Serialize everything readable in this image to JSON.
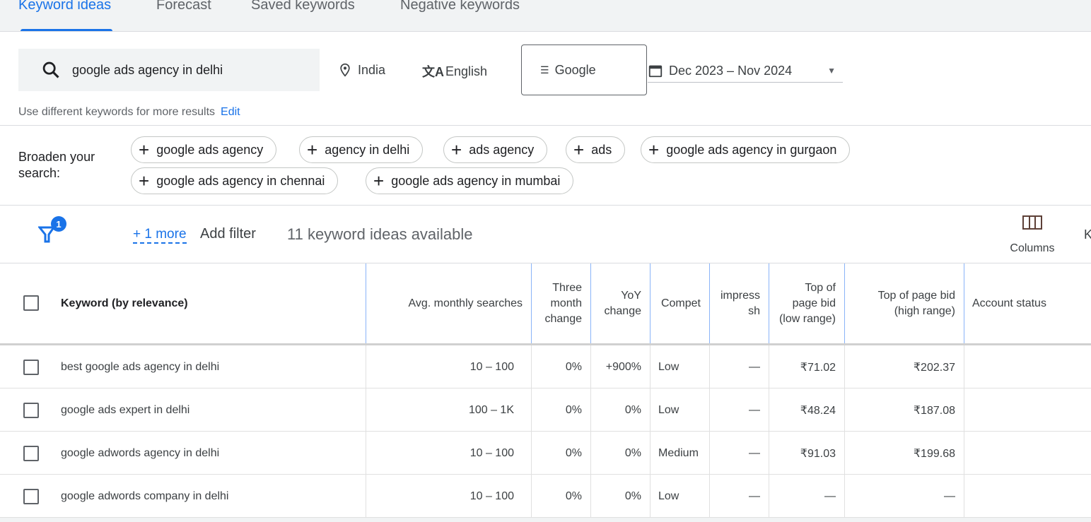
{
  "tabs": [
    {
      "label": "Keyword ideas",
      "active": true
    },
    {
      "label": "Forecast"
    },
    {
      "label": "Saved keywords"
    },
    {
      "label": "Negative keywords"
    }
  ],
  "search": {
    "value": "google ads agency in delhi",
    "icon": "search-icon"
  },
  "location": {
    "label": "India",
    "icon": "location-pin-icon"
  },
  "language": {
    "label": "English",
    "icon": "translate-icon"
  },
  "network": {
    "label": "Google",
    "icon": "search-network-icon"
  },
  "date_range": {
    "label": "Dec 2023 – Nov 2024",
    "icon": "calendar-icon"
  },
  "hint": {
    "text": "Use different keywords for more results",
    "link": "Edit"
  },
  "broaden": {
    "label": "Broaden your search:",
    "chips": [
      "google ads agency",
      "agency in delhi",
      "ads agency",
      "ads",
      "google ads agency in gurgaon",
      "google ads agency in chennai",
      "google ads agency in mumbai"
    ]
  },
  "filter": {
    "badge": "1",
    "more": "+ 1 more",
    "add": "Add filter",
    "count_text": "11 keyword ideas available",
    "columns": "Columns",
    "cut_label": "K"
  },
  "accent": "#1a73e8",
  "table": {
    "headers": [
      "Keyword (by relevance)",
      "Avg. monthly searches",
      "Three month change",
      "YoY change",
      "Compet",
      "impress sh",
      "Top of page bid (low range)",
      "Top of page bid (high range)",
      "Account status"
    ],
    "rows": [
      [
        "best google ads agency in delhi",
        "10 – 100",
        "0%",
        "+900%",
        "Low",
        "—",
        "₹71.02",
        "₹202.37",
        ""
      ],
      [
        "google ads expert in delhi",
        "100 – 1K",
        "0%",
        "0%",
        "Low",
        "—",
        "₹48.24",
        "₹187.08",
        ""
      ],
      [
        "google adwords agency in delhi",
        "10 – 100",
        "0%",
        "0%",
        "Medium",
        "—",
        "₹91.03",
        "₹199.68",
        ""
      ],
      [
        "google adwords company in delhi",
        "10 – 100",
        "0%",
        "0%",
        "Low",
        "—",
        "—",
        "—",
        ""
      ]
    ]
  }
}
